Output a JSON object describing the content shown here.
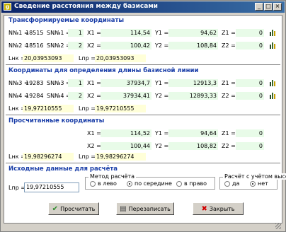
{
  "window": {
    "title": "Сведение расстояния между базисами",
    "icon_glyph": "g",
    "controls": [
      "_",
      "□",
      "×"
    ]
  },
  "section1": {
    "title": "Трансформируемые координаты",
    "row1": {
      "n_label": "N№1 =",
      "n_val": "18515",
      "sn_label": "SN№1 =",
      "sn_val": "1",
      "x_label": "X1 =",
      "x_val": "114,54",
      "y_label": "Y1 =",
      "y_val": "94,62",
      "z_label": "Z1 =",
      "z_val": "0"
    },
    "row2": {
      "n_label": "N№2 =",
      "n_val": "18516",
      "sn_label": "SN№2 =",
      "sn_val": "2",
      "x_label": "X2 =",
      "x_val": "100,42",
      "y_label": "Y2 =",
      "y_val": "108,84",
      "z_label": "Z2 =",
      "z_val": "0"
    },
    "lhk_label": "Lнк =",
    "lhk_val": "20,03953093",
    "lnp_label": "Lпр =",
    "lnp_val": "20,03953093"
  },
  "section2": {
    "title": "Координаты для определения длины базисной линии",
    "row1": {
      "n_label": "N№3 =",
      "n_val": "19283",
      "sn_label": "SN№3 =",
      "sn_val": "1",
      "x_label": "X1 =",
      "x_val": "37934,7",
      "y_label": "Y1 =",
      "y_val": "12913,3",
      "z_label": "Z1 =",
      "z_val": "0"
    },
    "row2": {
      "n_label": "N№4 =",
      "n_val": "19284",
      "sn_label": "SN№4 =",
      "sn_val": "2",
      "x_label": "X2 =",
      "x_val": "37934,41",
      "y_label": "Y2 =",
      "y_val": "12893,33",
      "z_label": "Z2 =",
      "z_val": "0"
    },
    "lhk_label": "Lнк =",
    "lhk_val": "19,97210555",
    "lnp_label": "Lпр =",
    "lnp_val": "19,97210555"
  },
  "section3": {
    "title": "Просчитанные координаты",
    "row1": {
      "x_label": "X1 =",
      "x_val": "114,52",
      "y_label": "Y1 =",
      "y_val": "94,64",
      "z_label": "Z1 =",
      "z_val": "0"
    },
    "row2": {
      "x_label": "X2 =",
      "x_val": "100,44",
      "y_label": "Y2 =",
      "y_val": "108,82",
      "z_label": "Z2 =",
      "z_val": "0"
    },
    "lhk_label": "Lнк =",
    "lhk_val": "19,98296274",
    "lnp_label": "Lпр =",
    "lnp_val": "19,98296274"
  },
  "section4": {
    "title": "Исходные данные для расчёта",
    "lnp_label": "Lпр =",
    "lnp_val": "19,97210555",
    "method_title": "Метод расчёта",
    "method_options": [
      "в лево",
      "по середине",
      "в право"
    ],
    "method_selected": 1,
    "height_title": "Расчёт с учётом высот",
    "height_options": [
      "да",
      "нет"
    ],
    "height_selected": 1
  },
  "buttons": {
    "calc": "Просчитать",
    "rewrite": "Перезаписать",
    "close": "Закрыть"
  },
  "colors": {
    "title_accent": "#1a3ea8",
    "field_green": "#e8fbe8",
    "field_yellow": "#ffffd8"
  }
}
